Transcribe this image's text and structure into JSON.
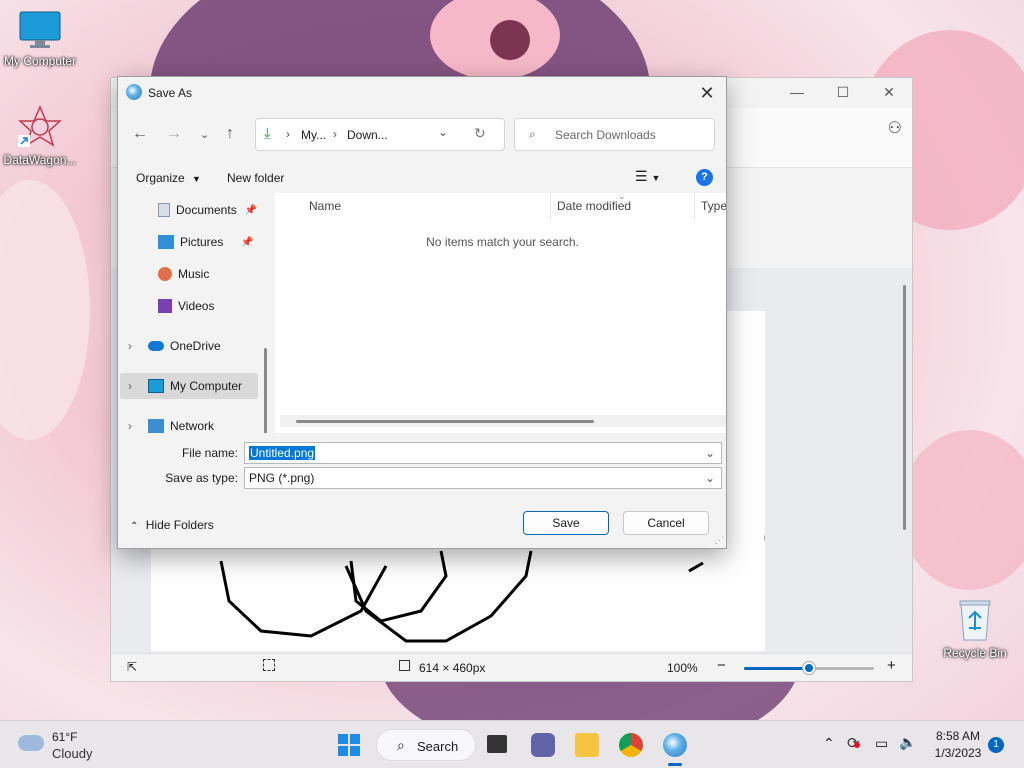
{
  "desktop": {
    "icons": [
      {
        "label": "My Computer"
      },
      {
        "label": "DataWagon..."
      },
      {
        "label": "Recycle Bin"
      }
    ]
  },
  "paint": {
    "status": {
      "canvas_size": "614 × 460px",
      "zoom": "100%",
      "zoom_level": 0.5
    }
  },
  "dialog": {
    "title": "Save As",
    "address": {
      "segments": [
        "My...",
        "Down..."
      ]
    },
    "search": {
      "placeholder": "Search Downloads"
    },
    "commands": {
      "organize": "Organize",
      "new_folder": "New folder"
    },
    "nav_items": [
      {
        "label": "Documents",
        "pinned": true
      },
      {
        "label": "Pictures",
        "pinned": true
      },
      {
        "label": "Music"
      },
      {
        "label": "Videos"
      },
      {
        "label": "OneDrive"
      },
      {
        "label": "My Computer",
        "selected": true
      },
      {
        "label": "Network"
      }
    ],
    "columns": [
      "Name",
      "Date modified",
      "Type"
    ],
    "empty_message": "No items match your search.",
    "file_name": {
      "label": "File name:",
      "value": "Untitled.png"
    },
    "save_type": {
      "label": "Save as type:",
      "value": "PNG (*.png)"
    },
    "hide_folders": "Hide Folders",
    "save_label": "Save",
    "cancel_label": "Cancel"
  },
  "taskbar": {
    "weather": {
      "temp": "61°F",
      "condition": "Cloudy"
    },
    "search_label": "Search",
    "clock": {
      "time": "8:58 AM",
      "date": "1/3/2023"
    },
    "notification_count": "1"
  },
  "colors": {
    "accent": "#0067c0",
    "selected_text_bg": "#0078d4"
  }
}
